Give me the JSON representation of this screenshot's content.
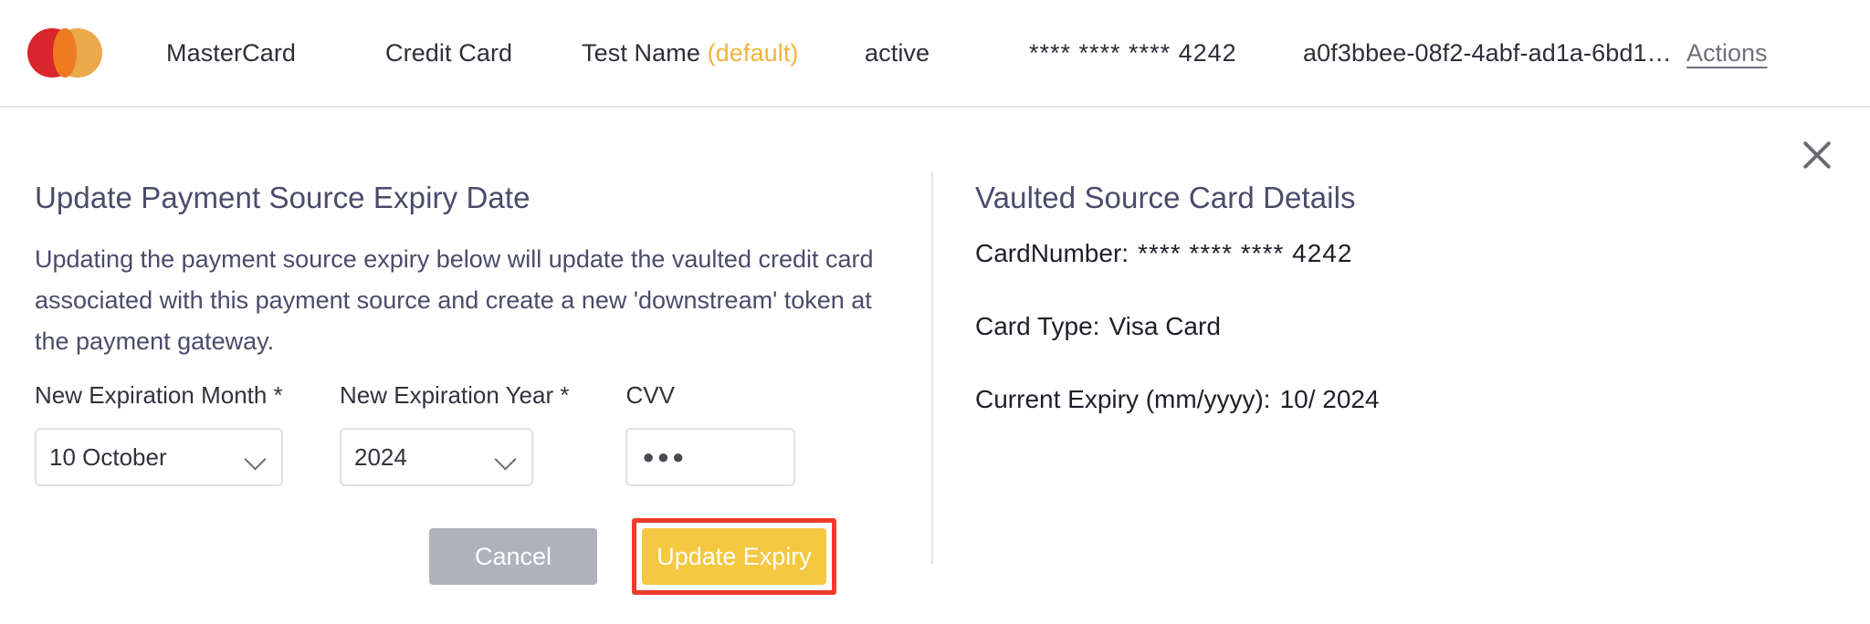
{
  "header": {
    "logo_name": "mastercard-logo",
    "brand": "MasterCard",
    "card_type": "Credit Card",
    "holder_name": "Test Name",
    "default_tag": "(default)",
    "status": "active",
    "masked_number": "**** **** **** 4242",
    "token_id": "a0f3bbee-08f2-4abf-ad1a-6bd1…",
    "actions_label": "Actions",
    "default_color": "#f2b33d"
  },
  "dialog": {
    "close_label": "×"
  },
  "left": {
    "title": "Update Payment Source Expiry Date",
    "description": "Updating the payment source expiry below will update the vaulted credit card associated with this payment source and create a new 'downstream' token at the payment gateway.",
    "fields": {
      "month_label": "New Expiration Month *",
      "month_value": "10 October",
      "year_label": "New Expiration Year *",
      "year_value": "2024",
      "cvv_label": "CVV",
      "cvv_value": "●●●"
    },
    "buttons": {
      "cancel": "Cancel",
      "submit": "Update Expiry",
      "cancel_color": "#adb2bd",
      "submit_color": "#f5c842",
      "highlight_color": "#ef3b2c"
    }
  },
  "right": {
    "title": "Vaulted Source Card Details",
    "details": [
      {
        "label": "CardNumber:",
        "value": "**** **** **** 4242"
      },
      {
        "label": "Card Type:",
        "value": "Visa Card"
      },
      {
        "label": "Current Expiry (mm/yyyy):",
        "value": "10/ 2024"
      }
    ]
  }
}
